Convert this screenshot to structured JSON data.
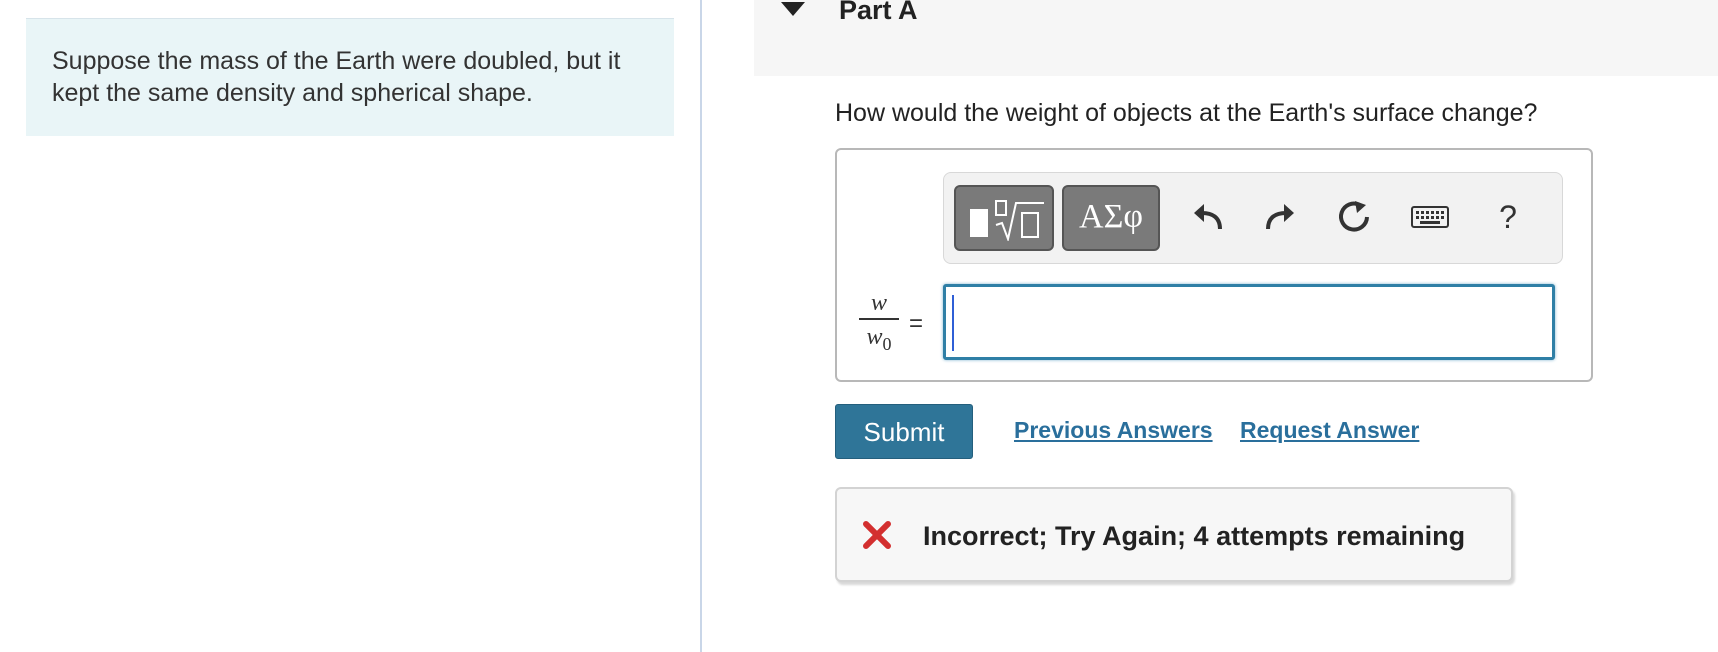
{
  "problem": {
    "text": "Suppose the mass of the Earth were doubled, but it kept the same density and spherical shape."
  },
  "part": {
    "title": "Part A",
    "question": "How would the weight of objects at the Earth's surface change?"
  },
  "toolbar": {
    "greek_label": "ΑΣφ",
    "help_label": "?"
  },
  "equation": {
    "numerator": "w",
    "denominator_var": "w",
    "denominator_sub": "0",
    "equals": "="
  },
  "input": {
    "value": ""
  },
  "actions": {
    "submit_label": "Submit",
    "previous_answers_label": "Previous Answers",
    "request_answer_label": "Request Answer"
  },
  "feedback": {
    "message": "Incorrect; Try Again; 4 attempts remaining",
    "status_color": "#d32f2f"
  },
  "colors": {
    "accent": "#2f7598",
    "link": "#2a6f9c",
    "problem_bg": "#e9f5f7"
  }
}
